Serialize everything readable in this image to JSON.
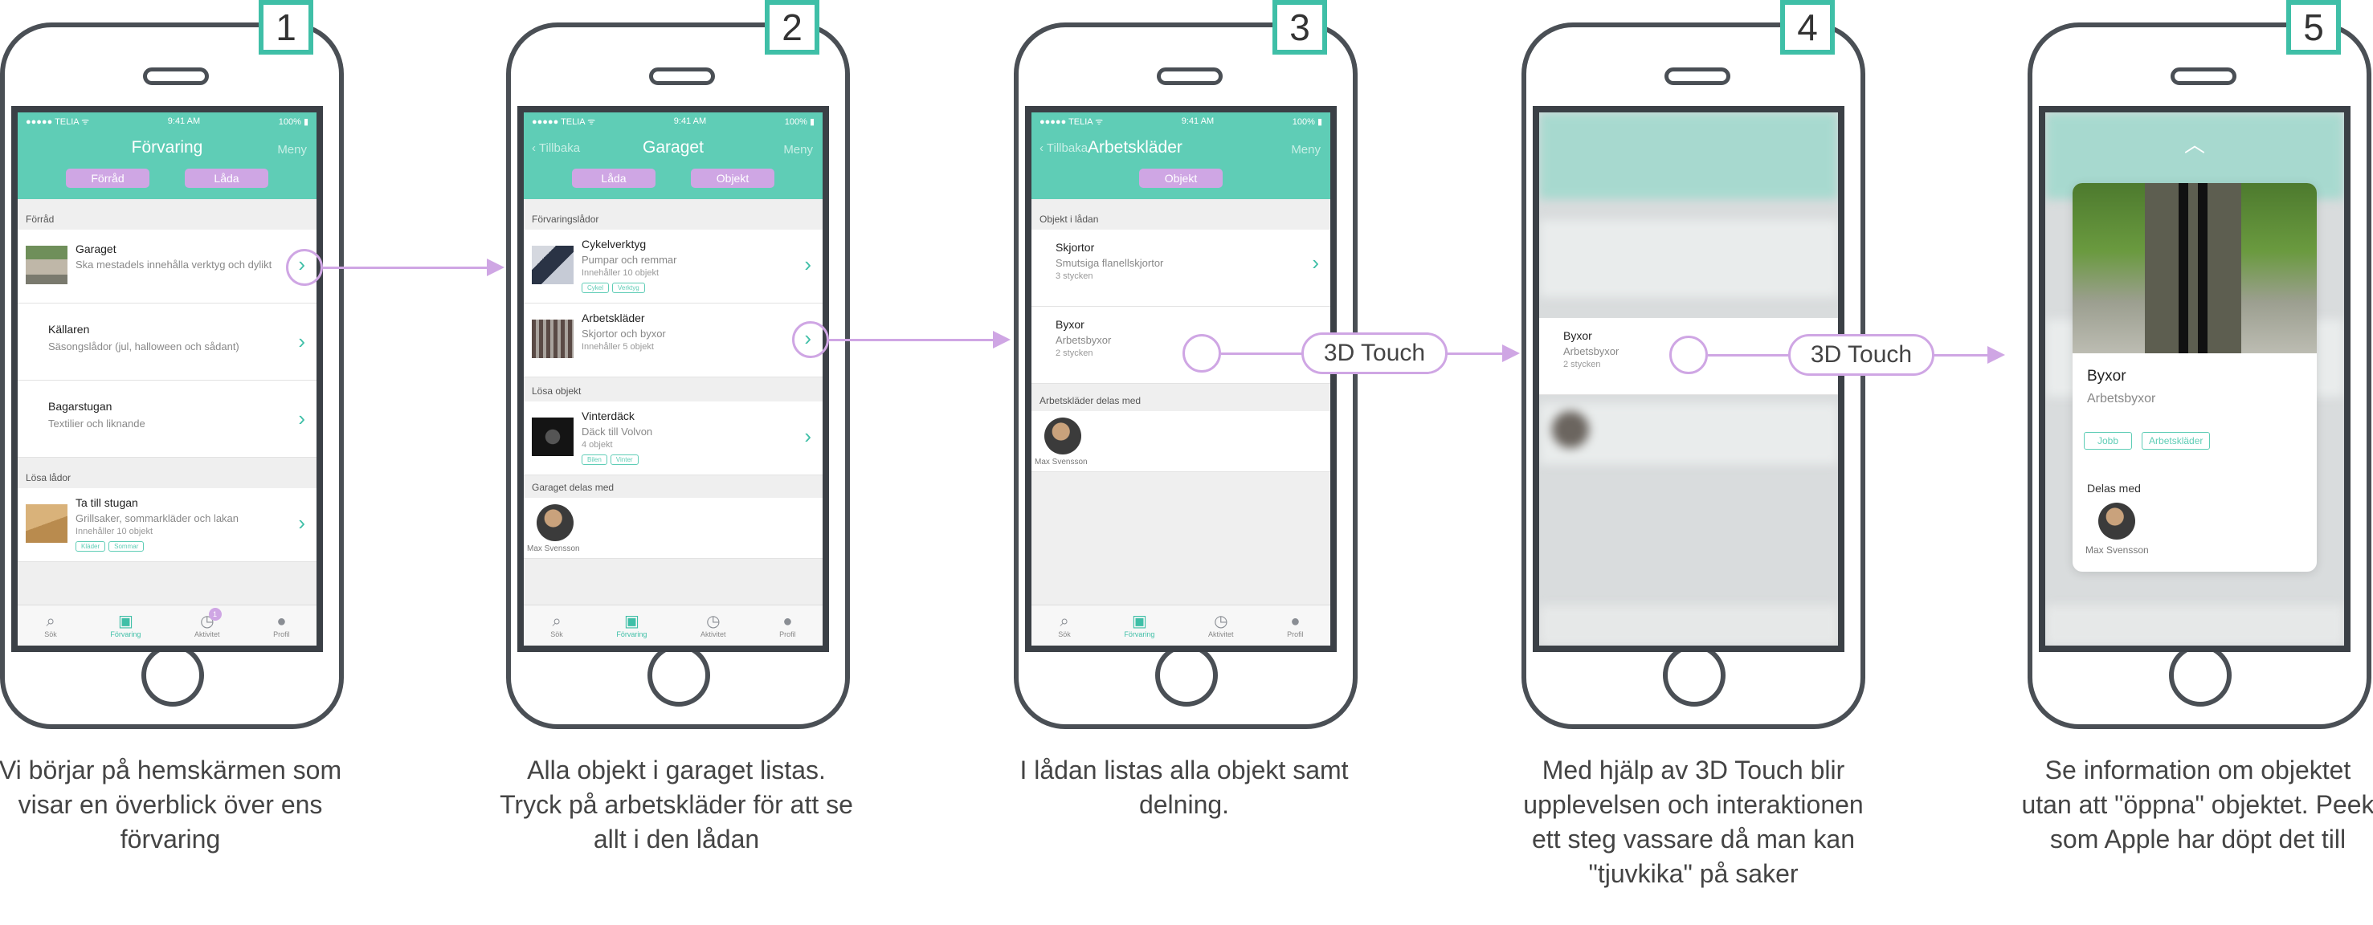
{
  "steps": [
    {
      "number": "1",
      "caption": "Vi börjar på hemskärmen som visar en överblick över ens förvaring"
    },
    {
      "number": "2",
      "caption": "Alla objekt i garaget listas. Tryck på arbetskläder för att se allt i den lådan"
    },
    {
      "number": "3",
      "caption": "I lådan listas alla objekt samt delning."
    },
    {
      "number": "4",
      "caption": "Med hjälp av 3D Touch blir upplevelsen och interaktionen ett steg vassare då man kan \"tjuvkika\" på saker"
    },
    {
      "number": "5",
      "caption": "Se information om objektet utan att \"öppna\" objektet. Peek som Apple har döpt det till"
    }
  ],
  "status": {
    "carrier": "●●●●● TELIA ᯤ",
    "time": "9:41 AM",
    "battery": "100% ▮"
  },
  "tabs": {
    "search": "Sök",
    "storage": "Förvaring",
    "activity": "Aktivitet",
    "profile": "Profil",
    "activity_badge": "1"
  },
  "labels": {
    "touch": "3D Touch",
    "owner": "Max Svensson",
    "back": "Tillbaka",
    "menu": "Meny"
  },
  "screen1": {
    "title": "Förvaring",
    "segments": [
      "Förråd",
      "Låda"
    ],
    "section1": "Förråd",
    "section2": "Lösa lådor",
    "items": [
      {
        "title": "Garaget",
        "sub": "Ska mestadels innehålla verktyg och dylikt"
      },
      {
        "title": "Källaren",
        "sub": "Säsongslådor (jul, halloween och sådant)"
      },
      {
        "title": "Bagarstugan",
        "sub": "Textilier och liknande"
      }
    ],
    "loose": {
      "title": "Ta till stugan",
      "sub": "Grillsaker, sommarkläder och lakan",
      "meta": "Innehåller 10 objekt",
      "tags": [
        "Kläder",
        "Sommar"
      ]
    }
  },
  "screen2": {
    "title": "Garaget",
    "segments": [
      "Låda",
      "Objekt"
    ],
    "section1": "Förvaringslådor",
    "section2": "Lösa objekt",
    "section3": "Garaget delas med",
    "items": [
      {
        "title": "Cykelverktyg",
        "sub": "Pumpar och remmar",
        "meta": "Innehåller 10 objekt",
        "tags": [
          "Cykel",
          "Verktyg"
        ]
      },
      {
        "title": "Arbetskläder",
        "sub": "Skjortor och byxor",
        "meta": "Innehåller 5 objekt"
      }
    ],
    "loose": {
      "title": "Vinterdäck",
      "sub": "Däck till Volvon",
      "meta": "4 objekt",
      "tags": [
        "Bilen",
        "Vinter"
      ]
    }
  },
  "screen3": {
    "title": "Arbetskläder",
    "segment": "Objekt",
    "section1": "Objekt i lådan",
    "section2": "Arbetskläder delas med",
    "items": [
      {
        "title": "Skjortor",
        "sub": "Smutsiga flanellskjortor",
        "meta": "3 stycken"
      },
      {
        "title": "Byxor",
        "sub": "Arbetsbyxor",
        "meta": "2 stycken"
      }
    ]
  },
  "screen4": {
    "item": {
      "title": "Byxor",
      "sub": "Arbetsbyxor",
      "meta": "2 stycken"
    }
  },
  "screen5": {
    "title": "Byxor",
    "sub": "Arbetsbyxor",
    "tags": [
      "Jobb",
      "Arbetskläder"
    ],
    "shared_label": "Delas med",
    "handle": "︿"
  },
  "colors": {
    "accent": "#5fcdb6",
    "highlight": "#cfa6e4",
    "frame": "#4a4f55"
  }
}
